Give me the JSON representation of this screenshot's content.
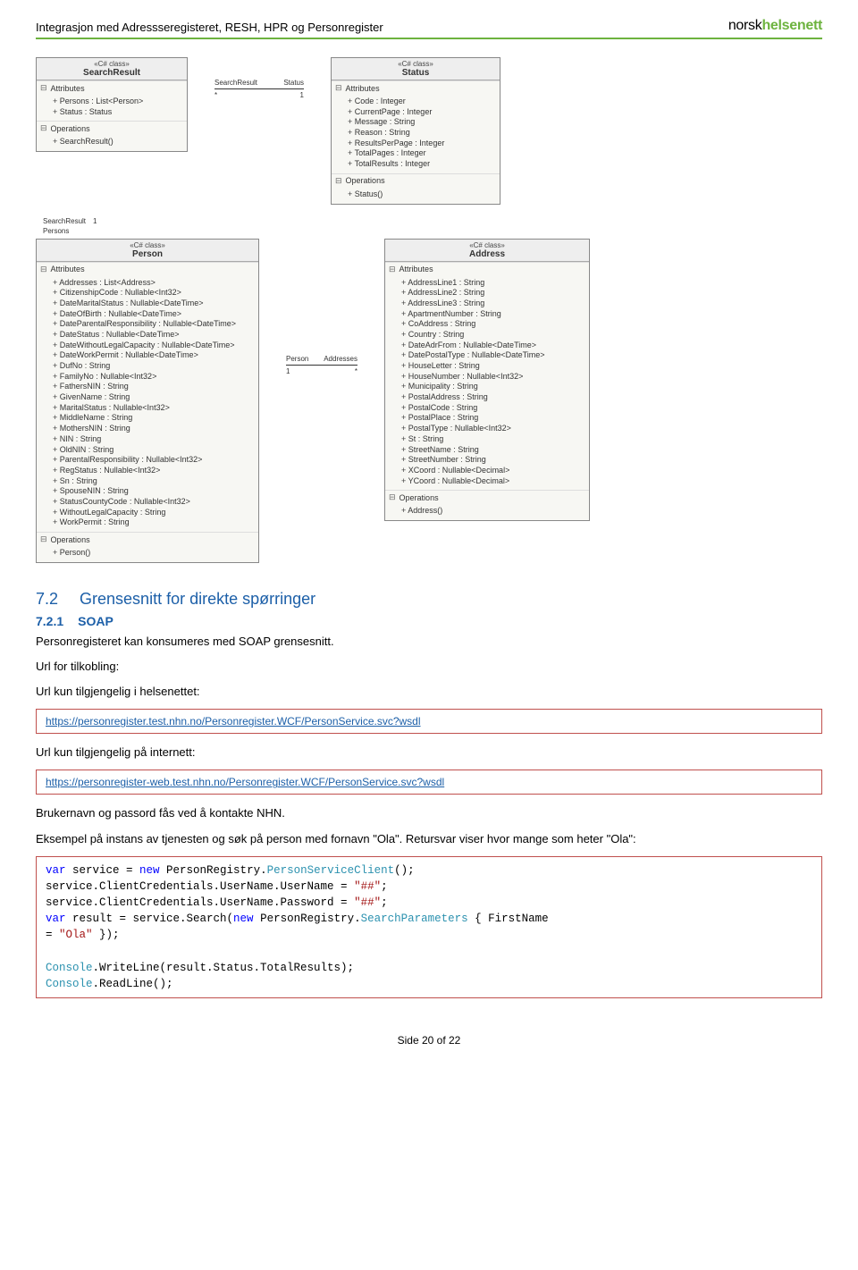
{
  "header": {
    "title": "Integrasjon med Adressseregisteret, RESH, HPR og Personregister",
    "logo_norsk": "norsk",
    "logo_helsenett": "helsenett"
  },
  "uml": {
    "stereo": "«C# class»",
    "attributes_label": "Attributes",
    "operations_label": "Operations",
    "search_result": {
      "name": "SearchResult",
      "attrs": [
        "Persons : List<Person>",
        "Status : Status"
      ],
      "ops": [
        "SearchResult()"
      ]
    },
    "status": {
      "name": "Status",
      "attrs": [
        "Code : Integer",
        "CurrentPage : Integer",
        "Message : String",
        "Reason : String",
        "ResultsPerPage : Integer",
        "TotalPages : Integer",
        "TotalResults : Integer"
      ],
      "ops": [
        "Status()"
      ]
    },
    "person": {
      "name": "Person",
      "attrs": [
        "Addresses : List<Address>",
        "CitizenshipCode : Nullable<Int32>",
        "DateMaritalStatus : Nullable<DateTime>",
        "DateOfBirth : Nullable<DateTime>",
        "DateParentalResponsibility : Nullable<DateTime>",
        "DateStatus : Nullable<DateTime>",
        "DateWithoutLegalCapacity : Nullable<DateTime>",
        "DateWorkPermit : Nullable<DateTime>",
        "DufNo : String",
        "FamilyNo : Nullable<Int32>",
        "FathersNIN : String",
        "GivenName : String",
        "MaritalStatus : Nullable<Int32>",
        "MiddleName : String",
        "MothersNIN : String",
        "NIN : String",
        "OldNIN : String",
        "ParentalResponsibility : Nullable<Int32>",
        "RegStatus : Nullable<Int32>",
        "Sn : String",
        "SpouseNIN : String",
        "StatusCountyCode : Nullable<Int32>",
        "WithoutLegalCapacity : String",
        "WorkPermit : String"
      ],
      "ops": [
        "Person()"
      ]
    },
    "address": {
      "name": "Address",
      "attrs": [
        "AddressLine1 : String",
        "AddressLine2 : String",
        "AddressLine3 : String",
        "ApartmentNumber : String",
        "CoAddress : String",
        "Country : String",
        "DateAdrFrom : Nullable<DateTime>",
        "DatePostalType : Nullable<DateTime>",
        "HouseLetter : String",
        "HouseNumber : Nullable<Int32>",
        "Municipality : String",
        "PostalAddress : String",
        "PostalCode : String",
        "PostalPlace : String",
        "PostalType : Nullable<Int32>",
        "St : String",
        "StreetName : String",
        "StreetNumber : String",
        "XCoord : Nullable<Decimal>",
        "YCoord : Nullable<Decimal>"
      ],
      "ops": [
        "Address()"
      ]
    },
    "assoc1": {
      "l": "SearchResult",
      "r": "Status",
      "lm": "*",
      "rm": "1"
    },
    "assoc2": {
      "l": "SearchResult",
      "r": "1",
      "t": "",
      "b": "Persons"
    },
    "assoc3": {
      "l": "Person",
      "r": "Addresses",
      "lm": "1",
      "rm": "*"
    }
  },
  "section": {
    "h2_num": "7.2",
    "h2_text": "Grensesnitt for direkte spørringer",
    "h3_num": "7.2.1",
    "h3_text": "SOAP",
    "p1": "Personregisteret kan konsumeres med SOAP grensesnitt.",
    "p2": "Url for tilkobling:",
    "p3": "Url kun tilgjengelig i helsenettet:",
    "link1": "https://personregister.test.nhn.no/Personregister.WCF/PersonService.svc?wsdl",
    "p4": "Url kun tilgjengelig på internett:",
    "link2": "https://personregister-web.test.nhn.no/Personregister.WCF/PersonService.svc?wsdl",
    "p5": "Brukernavn og passord fås ved å kontakte NHN.",
    "p6": "Eksempel på instans av tjenesten og søk på person med fornavn \"Ola\". Retursvar viser hvor mange som heter \"Ola\":"
  },
  "code": {
    "l1_a": "var",
    "l1_b": " service = ",
    "l1_c": "new",
    "l1_d": " PersonRegistry.",
    "l1_e": "PersonServiceClient",
    "l1_f": "();",
    "l2_a": "service.ClientCredentials.UserName.UserName = ",
    "l2_b": "\"##\"",
    "l2_c": ";",
    "l3_a": "service.ClientCredentials.UserName.Password = ",
    "l3_b": "\"##\"",
    "l3_c": ";",
    "l4_a": "var",
    "l4_b": " result = service.Search(",
    "l4_c": "new",
    "l4_d": " PersonRegistry.",
    "l4_e": "SearchParameters",
    "l4_f": " { FirstName",
    "l5_a": "= ",
    "l5_b": "\"Ola\"",
    "l5_c": " });",
    "l6_a": "Console",
    "l6_b": ".WriteLine(result.Status.TotalResults);",
    "l7_a": "Console",
    "l7_b": ".ReadLine();"
  },
  "footer": "Side 20 of 22"
}
